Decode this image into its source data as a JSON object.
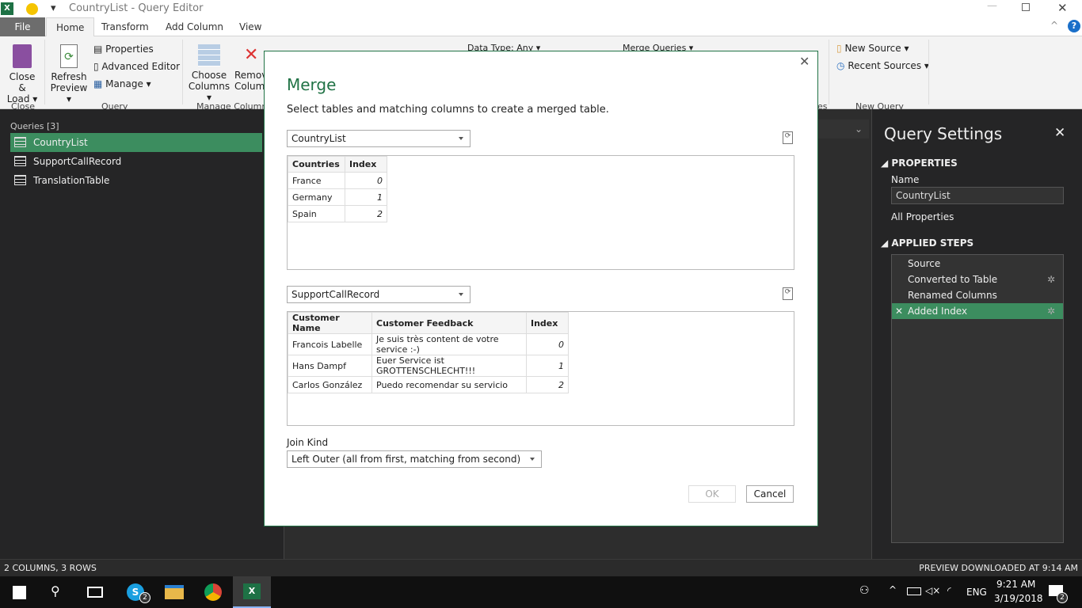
{
  "window": {
    "title": "CountryList - Query Editor"
  },
  "tabs": [
    "File",
    "Home",
    "Transform",
    "Add Column",
    "View"
  ],
  "ribbon": {
    "close_load": "Close &",
    "close_load2": "Load ▾",
    "refresh": "Refresh",
    "refresh2": "Preview ▾",
    "properties": "Properties",
    "advanced_editor": "Advanced Editor",
    "manage": "Manage ▾",
    "choose": "Choose",
    "choose2": "Columns ▾",
    "remove": "Remov",
    "remove2": "Column",
    "data_type": "Data Type: Any ▾",
    "merge_queries": "Merge Queries ▾",
    "new_source": "New Source ▾",
    "recent_sources": "Recent Sources ▾",
    "groups": {
      "close": "Close",
      "query": "Query",
      "manage_columns": "Manage Column",
      "es": "es",
      "new_query": "New Query"
    }
  },
  "queries": {
    "header": "Queries [3]",
    "items": [
      "CountryList",
      "SupportCallRecord",
      "TranslationTable"
    ]
  },
  "settings": {
    "title": "Query Settings",
    "properties": "PROPERTIES",
    "name_label": "Name",
    "name_value": "CountryList",
    "all_properties": "All Properties",
    "applied_steps": "APPLIED STEPS",
    "steps": [
      "Source",
      "Converted to Table",
      "Renamed Columns",
      "Added Index"
    ]
  },
  "dialog": {
    "title": "Merge",
    "subtitle": "Select tables and matching columns to create a merged table.",
    "table1": {
      "selected": "CountryList",
      "columns": [
        "Countries",
        "Index"
      ],
      "rows": [
        [
          "France",
          "0"
        ],
        [
          "Germany",
          "1"
        ],
        [
          "Spain",
          "2"
        ]
      ]
    },
    "table2": {
      "selected": "SupportCallRecord",
      "columns": [
        "Customer Name",
        "Customer Feedback",
        "Index"
      ],
      "rows": [
        [
          "Francois Labelle",
          "Je suis très content de votre service :-)",
          "0"
        ],
        [
          "Hans Dampf",
          "Euer Service ist GROTTENSCHLECHT!!!",
          "1"
        ],
        [
          "Carlos González",
          "Puedo recomendar su servicio",
          "2"
        ]
      ]
    },
    "join_kind_label": "Join Kind",
    "join_kind": "Left Outer (all from first, matching from second)",
    "ok": "OK",
    "cancel": "Cancel"
  },
  "status": {
    "left": "2 COLUMNS, 3 ROWS",
    "right": "PREVIEW DOWNLOADED AT 9:14 AM"
  },
  "taskbar": {
    "time": "9:21 AM",
    "date": "3/19/2018",
    "lang": "ENG",
    "skype_badge": "2",
    "notif_badge": "2"
  }
}
